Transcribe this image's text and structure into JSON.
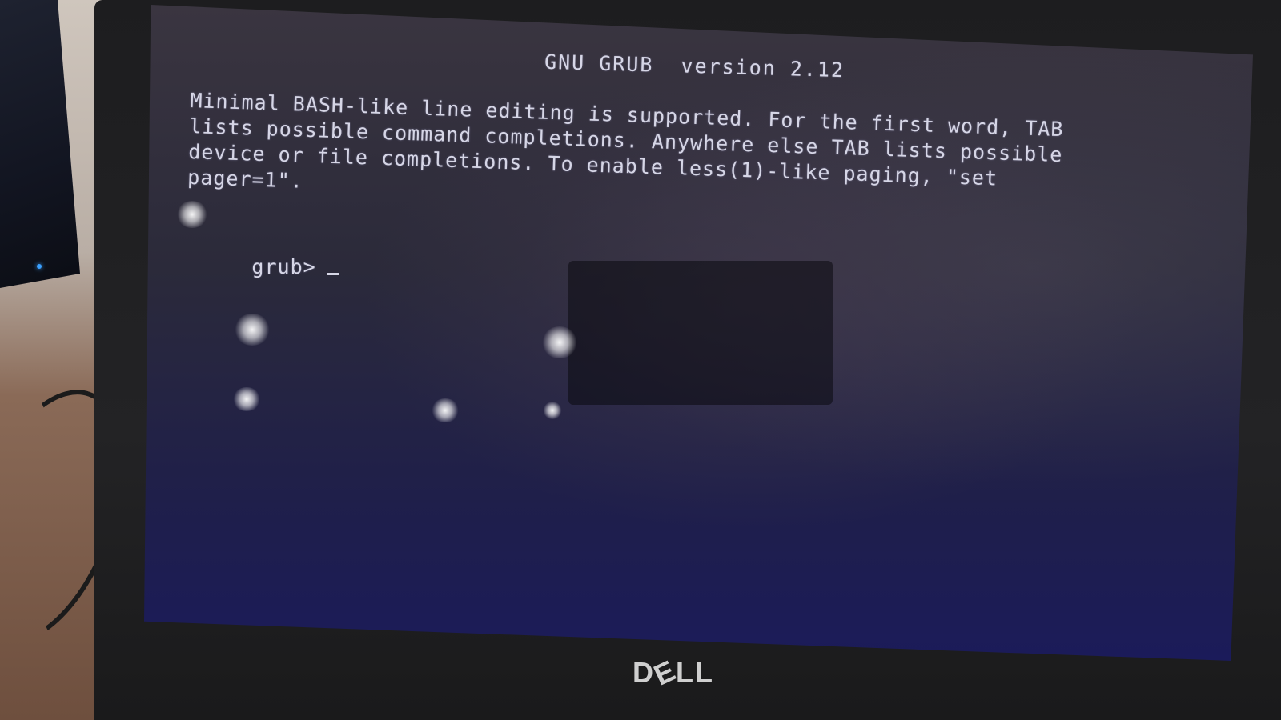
{
  "grub": {
    "header": "GNU GRUB  version 2.12",
    "help_lines": [
      "Minimal BASH-like line editing is supported. For the first word, TAB",
      "lists possible command completions. Anywhere else TAB lists possible",
      "device or file completions. To enable less(1)-like paging, \"set",
      "pager=1\"."
    ],
    "prompt": "grub>"
  },
  "brand": {
    "logo": "DELL",
    "logo_d": "D",
    "logo_e": "E",
    "logo_ll": "LL"
  },
  "colors": {
    "terminal_text": "#d6d6e6",
    "screen_background": "#1b1b5a",
    "bezel": "#1d1d1f"
  }
}
